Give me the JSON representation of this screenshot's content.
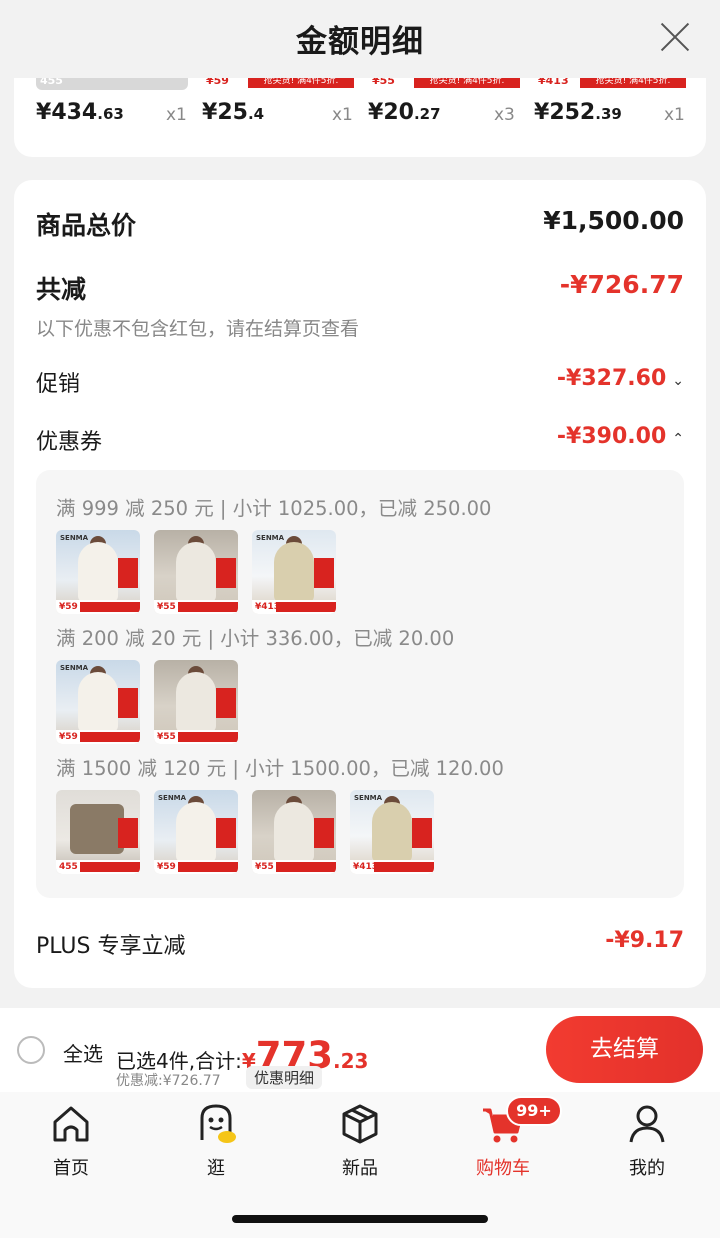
{
  "header": {
    "title": "金额明细"
  },
  "top_items": [
    {
      "strip_price": "455",
      "strip_text": "",
      "price_sym": "¥",
      "price_int": "434",
      "price_dec": ".63",
      "qty": "x1"
    },
    {
      "strip_price": "¥59",
      "strip_text": "抢尖货! 满4件5折.",
      "price_sym": "¥",
      "price_int": "25",
      "price_dec": ".4",
      "qty": "x1"
    },
    {
      "strip_price": "¥55",
      "strip_text": "抢尖货! 满4件5折.",
      "price_sym": "¥",
      "price_int": "20",
      "price_dec": ".27",
      "qty": "x3"
    },
    {
      "strip_price": "¥413",
      "strip_text": "抢尖货! 满4件5折.",
      "price_sym": "¥",
      "price_int": "252",
      "price_dec": ".39",
      "qty": "x1"
    }
  ],
  "summary": {
    "total_label": "商品总价",
    "total_value": "¥1,500.00",
    "reduce_label": "共减",
    "reduce_value": "-¥726.77",
    "note": "以下优惠不包含红包，请在结算页查看",
    "promo_label": "促销",
    "promo_value": "-¥327.60",
    "coupon_label": "优惠券",
    "coupon_value": "-¥390.00",
    "plus_label": "PLUS 专享立减",
    "plus_value": "-¥9.17"
  },
  "coupons": [
    {
      "text": "满 999 减 250 元 | 小计 1025.00，已减 250.00"
    },
    {
      "text": "满 200 减 20 元 | 小计 336.00，已减 20.00"
    },
    {
      "text": "满 1500 减 120 元 | 小计 1500.00，已减 120.00"
    }
  ],
  "thumb_prices": {
    "a": "¥59",
    "b": "¥55",
    "c": "¥413",
    "d": "455"
  },
  "thumb_logo": "SENMA",
  "bottom": {
    "select_all": "全选",
    "selected_text": "已选4件,合计:",
    "total_sym": "¥",
    "total_int": "773",
    "total_dec": ".23",
    "discount_text": "优惠减:¥726.77",
    "detail_label": "优惠明细",
    "checkout_label": "去结算"
  },
  "tabs": [
    {
      "label": "首页",
      "icon": "home-icon"
    },
    {
      "label": "逛",
      "icon": "browse-icon"
    },
    {
      "label": "新品",
      "icon": "box-icon"
    },
    {
      "label": "购物车",
      "icon": "cart-icon"
    },
    {
      "label": "我的",
      "icon": "user-icon"
    }
  ],
  "cart_badge": "99+",
  "colors": {
    "accent": "#e4332b",
    "background": "#f2f2f2"
  }
}
